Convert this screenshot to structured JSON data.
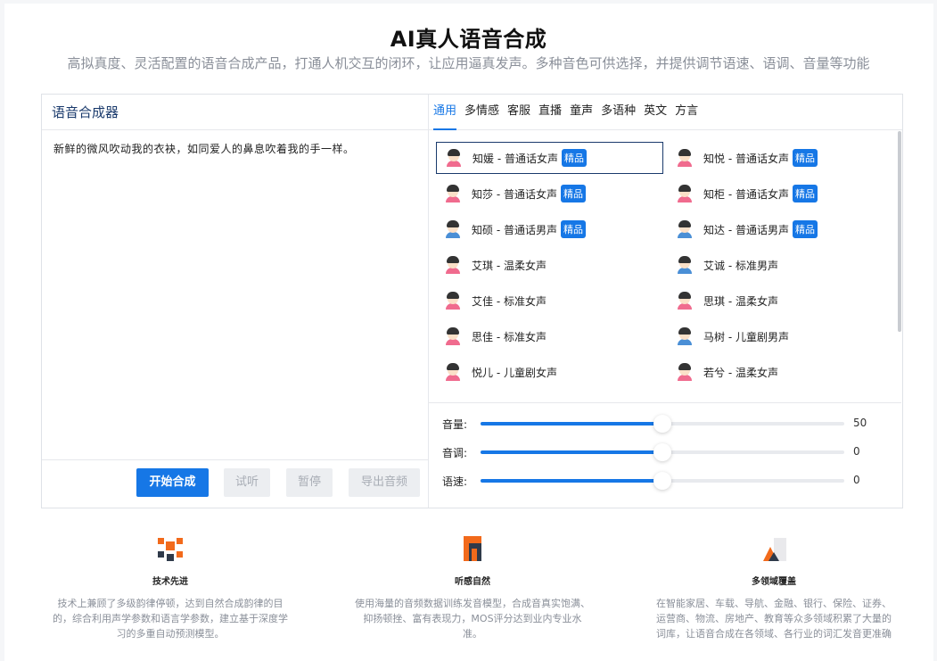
{
  "header": {
    "title": "AI真人语音合成",
    "subtitle": "高拟真度、灵活配置的语音合成产品，打通人机交互的闭环，让应用逼真发声。多种音色可供选择，并提供调节语速、语调、音量等功能"
  },
  "synth": {
    "title": "语音合成器",
    "text": "新鲜的微风吹动我的衣袂，如同爱人的鼻息吹着我的手一样。",
    "buttons": {
      "start": "开始合成",
      "listen": "试听",
      "pause": "暂停",
      "export": "导出音频"
    }
  },
  "tabs": [
    "通用",
    "多情感",
    "客服",
    "直播",
    "童声",
    "多语种",
    "英文",
    "方言"
  ],
  "badge_label": "精品",
  "voices": [
    {
      "name": "知媛 - 普通话女声",
      "premium": true,
      "gender": "f",
      "selected": true
    },
    {
      "name": "知悦 - 普通话女声",
      "premium": true,
      "gender": "f"
    },
    {
      "name": "知莎 - 普通话女声",
      "premium": true,
      "gender": "f"
    },
    {
      "name": "知柜 - 普通话女声",
      "premium": true,
      "gender": "f"
    },
    {
      "name": "知硕 - 普通话男声",
      "premium": true,
      "gender": "m"
    },
    {
      "name": "知达 - 普通话男声",
      "premium": true,
      "gender": "m"
    },
    {
      "name": "艾琪 - 温柔女声",
      "gender": "f"
    },
    {
      "name": "艾诚 - 标准男声",
      "gender": "m"
    },
    {
      "name": "艾佳 - 标准女声",
      "gender": "f"
    },
    {
      "name": "思琪 - 温柔女声",
      "gender": "f"
    },
    {
      "name": "思佳 - 标准女声",
      "gender": "f"
    },
    {
      "name": "马树 - 儿童剧男声",
      "gender": "m"
    },
    {
      "name": "悦儿 - 儿童剧女声",
      "gender": "f"
    },
    {
      "name": "若兮 - 温柔女声",
      "gender": "f"
    }
  ],
  "sliders": [
    {
      "label": "音量:",
      "value": "50",
      "fraction": 0.5
    },
    {
      "label": "音调:",
      "value": "0",
      "fraction": 0.5
    },
    {
      "label": "语速:",
      "value": "0",
      "fraction": 0.5
    }
  ],
  "features": [
    {
      "title": "技术先进",
      "desc": [
        "技术上兼顾了多级韵律停顿，达到自然合成韵律的目",
        "的，综合利用声学参数和语言学参数，建立基于深度学",
        "习的多重自动预测模型。"
      ]
    },
    {
      "title": "听感自然",
      "desc": [
        "使用海量的音频数据训练发音模型，合成音真实饱满、",
        "抑扬顿挫、富有表现力，MOS评分达到业内专业水",
        "准。"
      ]
    },
    {
      "title": "多领域覆盖",
      "desc": [
        "在智能家居、车载、导航、金融、银行、保险、证券、",
        "运营商、物流、房地产、教育等众多领域积累了大量的",
        "词库，让语音合成在各领域、各行业的词汇发音更准确"
      ]
    }
  ],
  "colors": {
    "accent": "#1677e6",
    "title_dark": "#1a3a6c"
  }
}
